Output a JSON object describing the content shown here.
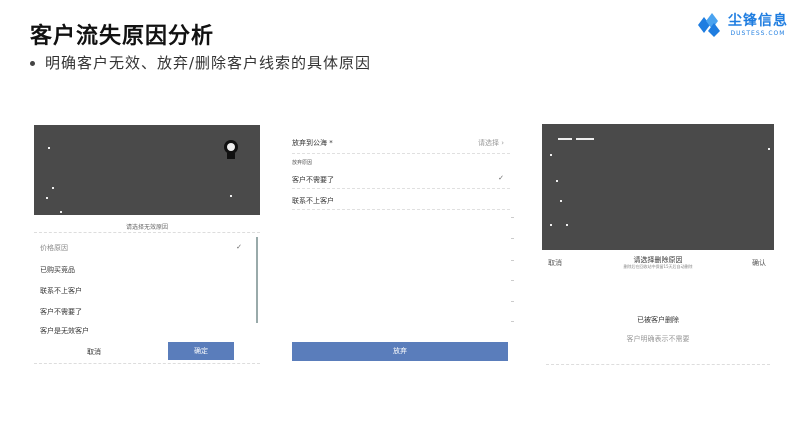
{
  "slide": {
    "title": "客户流失原因分析",
    "subtitle": "明确客户无效、放弃/删除客户线索的具体原因"
  },
  "logo": {
    "name_cn": "尘锋信息",
    "name_en": "DUSTESS.COM",
    "brand_color": "#1f7de0"
  },
  "panel1": {
    "hint": "请选择无效原因",
    "options": [
      {
        "label": "价格原因",
        "checked": true
      },
      {
        "label": "已购买竞品",
        "checked": false
      },
      {
        "label": "联系不上客户",
        "checked": false
      },
      {
        "label": "客户不需要了",
        "checked": false
      },
      {
        "label": "客户是无效客户",
        "checked": false
      }
    ],
    "check_mark": "✓",
    "cancel_label": "取消",
    "confirm_label": "确定"
  },
  "panel2": {
    "field_label": "放弃到公海 *",
    "field_placeholder": "请选择 ›",
    "section_label": "放弃原因",
    "option_selected": "客户不需要了",
    "option_other": "联系不上客户",
    "check_mark": "✓",
    "button_label": "放弃"
  },
  "panel3": {
    "cancel_label": "取消",
    "title": "请选择删除原因",
    "subtitle": "删除后在回收站中保留15天后自动删除",
    "confirm_label": "确认",
    "option1": "已被客户删除",
    "option2": "客户明确表示不需要"
  },
  "colors": {
    "primary_button": "#5a7dbb",
    "dark_overlay": "#4a4a4a"
  }
}
